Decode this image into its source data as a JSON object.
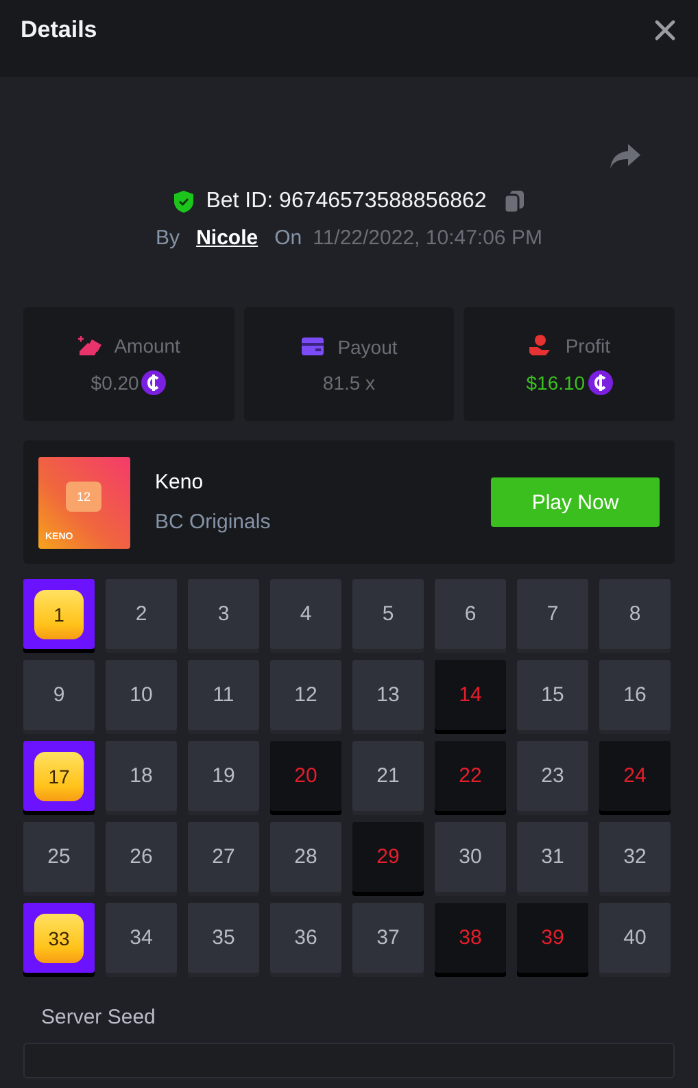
{
  "header": {
    "title": "Details"
  },
  "bet": {
    "id_label": "Bet ID: 96746573588856862",
    "by_label": "By",
    "user": "Nicole",
    "on_label": "On",
    "time": "11/22/2022, 10:47:06 PM"
  },
  "stats": [
    {
      "kind": "amount",
      "label": "Amount",
      "value": "$0.20",
      "coin": true,
      "positive": false
    },
    {
      "kind": "payout",
      "label": "Payout",
      "value": "81.5 x",
      "coin": false,
      "positive": false
    },
    {
      "kind": "profit",
      "label": "Profit",
      "value": "$16.10",
      "coin": true,
      "positive": true
    }
  ],
  "game": {
    "thumb_number": "12",
    "thumb_label": "KENO",
    "name": "Keno",
    "provider": "BC Originals",
    "button": "Play Now"
  },
  "cells": [
    {
      "n": "1",
      "hit": true,
      "drawn": true
    },
    {
      "n": "2",
      "hit": false,
      "drawn": false
    },
    {
      "n": "3",
      "hit": false,
      "drawn": false
    },
    {
      "n": "4",
      "hit": false,
      "drawn": false
    },
    {
      "n": "5",
      "hit": false,
      "drawn": false
    },
    {
      "n": "6",
      "hit": false,
      "drawn": false
    },
    {
      "n": "7",
      "hit": false,
      "drawn": false
    },
    {
      "n": "8",
      "hit": false,
      "drawn": false
    },
    {
      "n": "9",
      "hit": false,
      "drawn": false
    },
    {
      "n": "10",
      "hit": false,
      "drawn": false
    },
    {
      "n": "11",
      "hit": false,
      "drawn": false
    },
    {
      "n": "12",
      "hit": false,
      "drawn": false
    },
    {
      "n": "13",
      "hit": false,
      "drawn": false
    },
    {
      "n": "14",
      "hit": false,
      "drawn": true
    },
    {
      "n": "15",
      "hit": false,
      "drawn": false
    },
    {
      "n": "16",
      "hit": false,
      "drawn": false
    },
    {
      "n": "17",
      "hit": true,
      "drawn": true
    },
    {
      "n": "18",
      "hit": false,
      "drawn": false
    },
    {
      "n": "19",
      "hit": false,
      "drawn": false
    },
    {
      "n": "20",
      "hit": false,
      "drawn": true
    },
    {
      "n": "21",
      "hit": false,
      "drawn": false
    },
    {
      "n": "22",
      "hit": false,
      "drawn": true
    },
    {
      "n": "23",
      "hit": false,
      "drawn": false
    },
    {
      "n": "24",
      "hit": false,
      "drawn": true
    },
    {
      "n": "25",
      "hit": false,
      "drawn": false
    },
    {
      "n": "26",
      "hit": false,
      "drawn": false
    },
    {
      "n": "27",
      "hit": false,
      "drawn": false
    },
    {
      "n": "28",
      "hit": false,
      "drawn": false
    },
    {
      "n": "29",
      "hit": false,
      "drawn": true
    },
    {
      "n": "30",
      "hit": false,
      "drawn": false
    },
    {
      "n": "31",
      "hit": false,
      "drawn": false
    },
    {
      "n": "32",
      "hit": false,
      "drawn": false
    },
    {
      "n": "33",
      "hit": true,
      "drawn": true
    },
    {
      "n": "34",
      "hit": false,
      "drawn": false
    },
    {
      "n": "35",
      "hit": false,
      "drawn": false
    },
    {
      "n": "36",
      "hit": false,
      "drawn": false
    },
    {
      "n": "37",
      "hit": false,
      "drawn": false
    },
    {
      "n": "38",
      "hit": false,
      "drawn": true
    },
    {
      "n": "39",
      "hit": false,
      "drawn": true
    },
    {
      "n": "40",
      "hit": false,
      "drawn": false
    }
  ],
  "server_seed": {
    "label": "Server Seed"
  }
}
